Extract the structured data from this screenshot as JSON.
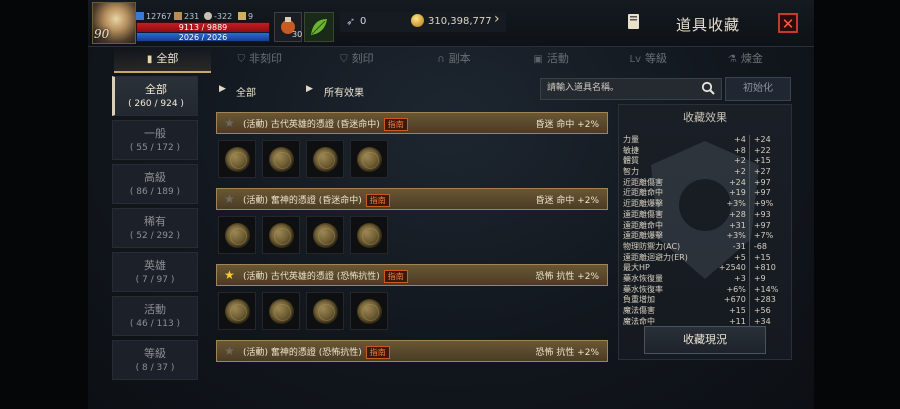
{
  "player": {
    "level": "90",
    "stat_a": "12767",
    "stat_b": "231",
    "stat_c": "-322",
    "stat_d": "9",
    "hp": "9113 / 9889",
    "mp": "2026 / 2026",
    "potion_count": "30"
  },
  "currency": {
    "gems": "0",
    "gold": "310,398,777"
  },
  "window": {
    "title": "道具收藏",
    "close": "✕"
  },
  "tabs": [
    {
      "label": "全部",
      "icon": "book-icon"
    },
    {
      "label": "非刻印",
      "icon": "shield-icon"
    },
    {
      "label": "刻印",
      "icon": "shield-icon"
    },
    {
      "label": "副本",
      "icon": "helmet-icon"
    },
    {
      "label": "活動",
      "icon": "gift-icon"
    },
    {
      "label": "等級",
      "icon": "level-icon"
    },
    {
      "label": "煉金",
      "icon": "alchemy-icon"
    }
  ],
  "categories": [
    {
      "name": "全部",
      "count": "( 260 / 924 )"
    },
    {
      "name": "一般",
      "count": "( 55 / 172 )"
    },
    {
      "name": "高級",
      "count": "( 86 / 189 )"
    },
    {
      "name": "稀有",
      "count": "( 52 / 292 )"
    },
    {
      "name": "英雄",
      "count": "( 7 / 97 )"
    },
    {
      "name": "活動",
      "count": "( 46 / 113 )"
    },
    {
      "name": "等級",
      "count": "( 8 / 37 )"
    }
  ],
  "filters": {
    "grade": "全部",
    "effect": "所有效果",
    "search_placeholder": "請輸入道具名稱。",
    "reset": "初始化"
  },
  "sets": [
    {
      "name": "(活動) 古代英雄的憑證 (昏迷命中)",
      "tag": "指南",
      "effect": "昏迷 命中 +2%",
      "starred": false
    },
    {
      "name": "(活動) 奮神的憑證 (昏迷命中)",
      "tag": "指南",
      "effect": "昏迷 命中 +2%",
      "starred": false
    },
    {
      "name": "(活動) 古代英雄的憑證 (恐怖抗性)",
      "tag": "指南",
      "effect": "恐怖 抗性 +2%",
      "starred": true
    },
    {
      "name": "(活動) 奮神的憑證 (恐怖抗性)",
      "tag": "指南",
      "effect": "恐怖 抗性 +2%",
      "starred": false
    }
  ],
  "effects": {
    "title": "收藏效果",
    "rows": [
      {
        "name": "力量",
        "v1": "+4",
        "v2": "+24"
      },
      {
        "name": "敏捷",
        "v1": "+8",
        "v2": "+22"
      },
      {
        "name": "體質",
        "v1": "+2",
        "v2": "+15"
      },
      {
        "name": "智力",
        "v1": "+2",
        "v2": "+27"
      },
      {
        "name": "近距離傷害",
        "v1": "+24",
        "v2": "+97"
      },
      {
        "name": "近距離命中",
        "v1": "+19",
        "v2": "+97"
      },
      {
        "name": "近距離爆擊",
        "v1": "+3%",
        "v2": "+9%"
      },
      {
        "name": "遠距離傷害",
        "v1": "+28",
        "v2": "+93"
      },
      {
        "name": "遠距離命中",
        "v1": "+31",
        "v2": "+97"
      },
      {
        "name": "遠距離爆擊",
        "v1": "+3%",
        "v2": "+7%"
      },
      {
        "name": "物理防禦力(AC)",
        "v1": "-31",
        "v2": "-68"
      },
      {
        "name": "遠距離迴避力(ER)",
        "v1": "+5",
        "v2": "+15"
      },
      {
        "name": "最大HP",
        "v1": "+2540",
        "v2": "+810"
      },
      {
        "name": "藥水恢復量",
        "v1": "+3",
        "v2": "+9"
      },
      {
        "name": "藥水恢復率",
        "v1": "+6%",
        "v2": "+14%"
      },
      {
        "name": "負重增加",
        "v1": "+670",
        "v2": "+283"
      },
      {
        "name": "魔法傷害",
        "v1": "+15",
        "v2": "+56"
      },
      {
        "name": "魔法命中",
        "v1": "+11",
        "v2": "+34"
      }
    ],
    "status_button": "收藏現況"
  }
}
